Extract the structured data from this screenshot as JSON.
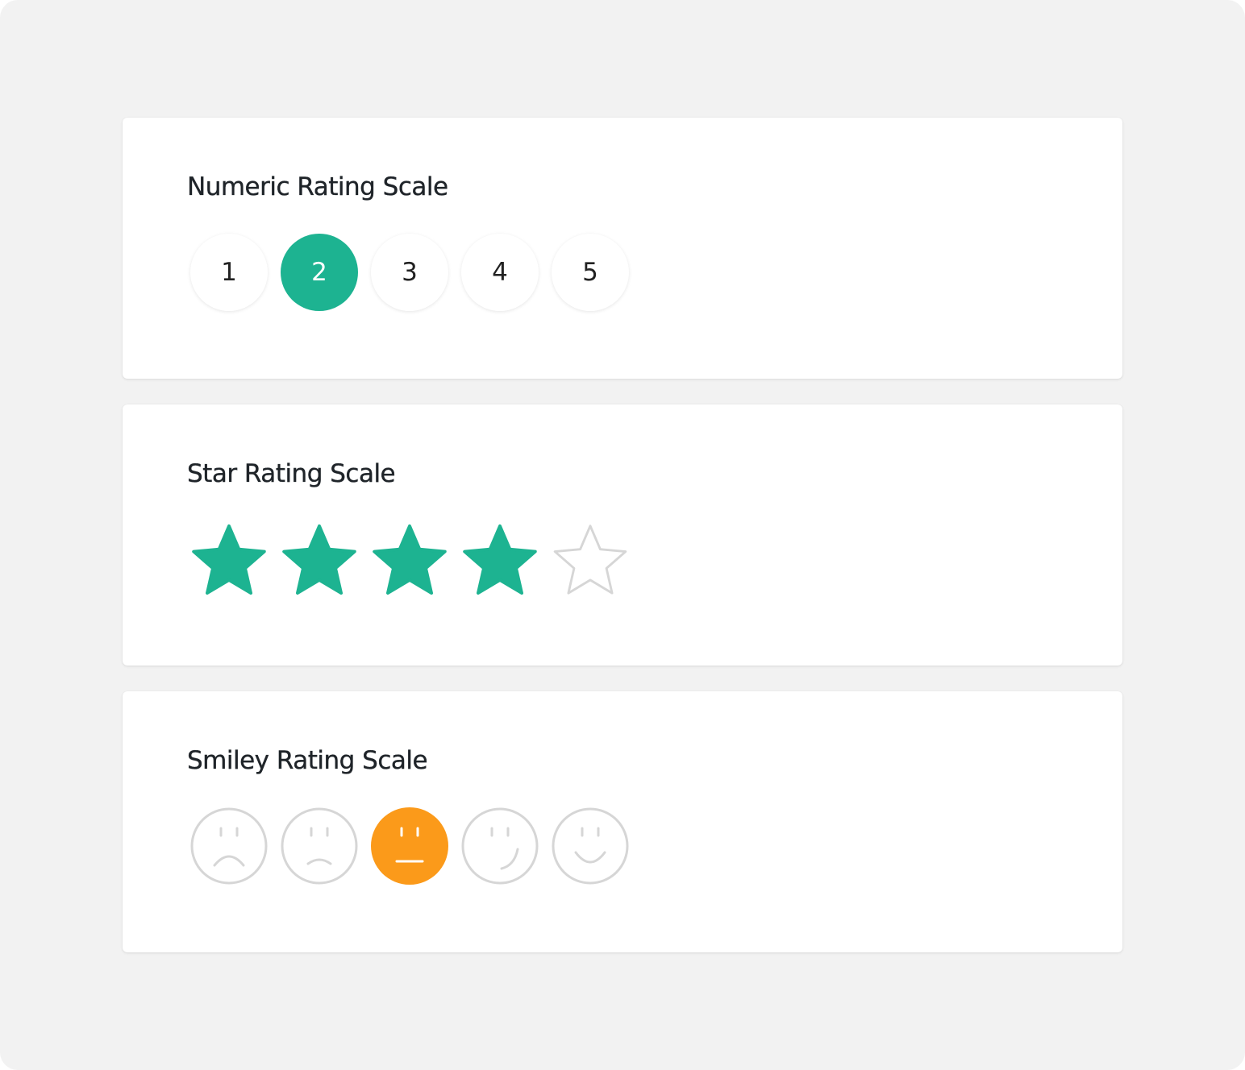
{
  "colors": {
    "background": "#f2f2f2",
    "card": "#ffffff",
    "accent": "#1db391",
    "smiley_selected": "#fb9a1a",
    "inactive_outline": "#d6d6d6"
  },
  "numeric": {
    "title": "Numeric Rating Scale",
    "options": [
      "1",
      "2",
      "3",
      "4",
      "5"
    ],
    "selected_value": 2
  },
  "star": {
    "title": "Star Rating Scale",
    "max": 5,
    "value": 4,
    "icon": "star-icon"
  },
  "smiley": {
    "title": "Smiley Rating Scale",
    "options": [
      {
        "icon": "very-sad-face-icon"
      },
      {
        "icon": "sad-face-icon"
      },
      {
        "icon": "neutral-face-icon"
      },
      {
        "icon": "smirk-face-icon"
      },
      {
        "icon": "happy-face-icon"
      }
    ],
    "selected_index": 2
  }
}
